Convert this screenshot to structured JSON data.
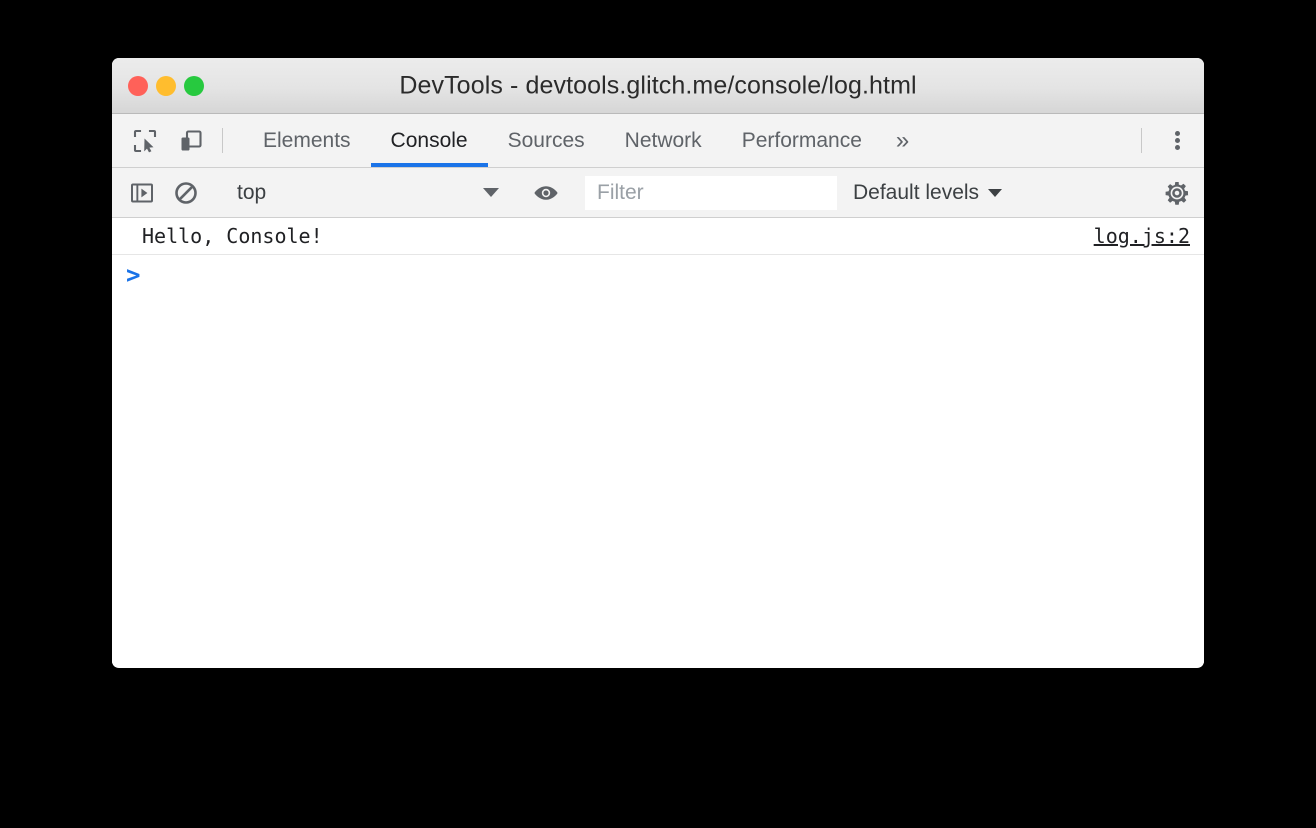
{
  "window": {
    "title": "DevTools - devtools.glitch.me/console/log.html",
    "traffic_lights": {
      "close_color": "#ff6159",
      "minimize_color": "#ffbd2e",
      "maximize_color": "#27c93f"
    }
  },
  "toolbar": {
    "inspect_icon": "inspect-element-icon",
    "device_icon": "device-toolbar-icon",
    "overflow_label": "»",
    "menu_icon": "kebab-menu-icon"
  },
  "tabs": [
    {
      "label": "Elements",
      "active": false
    },
    {
      "label": "Console",
      "active": true
    },
    {
      "label": "Sources",
      "active": false
    },
    {
      "label": "Network",
      "active": false
    },
    {
      "label": "Performance",
      "active": false
    }
  ],
  "console_toolbar": {
    "sidebar_toggle_icon": "console-sidebar-toggle-icon",
    "clear_icon": "clear-console-icon",
    "context": {
      "value": "top",
      "caret": "chevron-down-icon"
    },
    "eye_icon": "live-expression-eye-icon",
    "filter": {
      "value": "",
      "placeholder": "Filter"
    },
    "levels": {
      "label": "Default levels",
      "caret": "chevron-down-icon"
    },
    "settings_icon": "settings-gear-icon"
  },
  "console_messages": [
    {
      "text": "Hello, Console!",
      "source": "log.js:2"
    }
  ],
  "prompt": {
    "caret": ">",
    "value": ""
  },
  "colors": {
    "accent": "#1a73e8",
    "toolbar_bg": "#f3f3f3",
    "titlebar_bg": "#e4e4e4",
    "text": "#3c4043",
    "icon": "#5f6368"
  }
}
